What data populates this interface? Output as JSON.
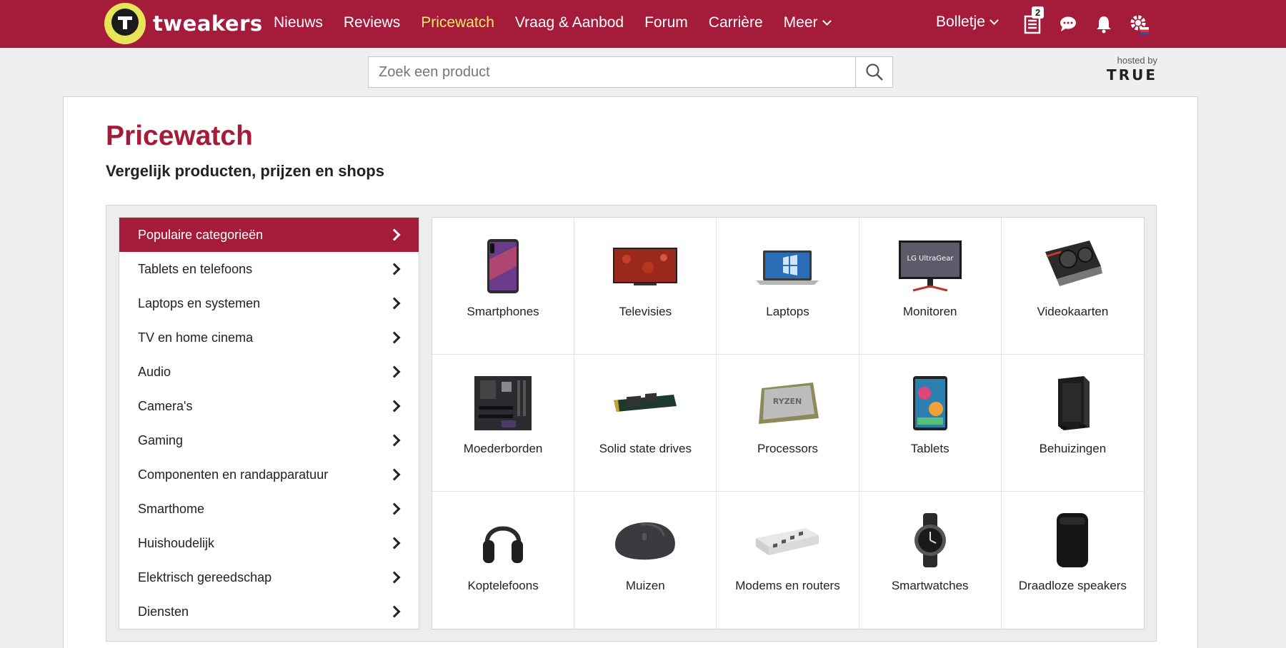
{
  "brand": {
    "name": "tweakers",
    "accent": "#a51c3a",
    "highlight": "#f3e96a"
  },
  "nav": {
    "items": [
      {
        "label": "Nieuws"
      },
      {
        "label": "Reviews"
      },
      {
        "label": "Pricewatch",
        "active": true
      },
      {
        "label": "Vraag & Aanbod"
      },
      {
        "label": "Forum"
      },
      {
        "label": "Carrière"
      },
      {
        "label": "Meer"
      }
    ],
    "user": "Bolletje",
    "list_badge": "2"
  },
  "search": {
    "placeholder": "Zoek een product"
  },
  "hosted": {
    "label": "hosted by",
    "brand": "TRUE"
  },
  "page": {
    "title": "Pricewatch",
    "subtitle": "Vergelijk producten, prijzen en shops"
  },
  "categories": [
    "Populaire categorieën",
    "Tablets en telefoons",
    "Laptops en systemen",
    "TV en home cinema",
    "Audio",
    "Camera's",
    "Gaming",
    "Componenten en randapparatuur",
    "Smarthome",
    "Huishoudelijk",
    "Elektrisch gereedschap",
    "Diensten"
  ],
  "products": [
    {
      "label": "Smartphones",
      "icon": "smartphone-icon"
    },
    {
      "label": "Televisies",
      "icon": "television-icon"
    },
    {
      "label": "Laptops",
      "icon": "laptop-icon"
    },
    {
      "label": "Monitoren",
      "icon": "monitor-icon"
    },
    {
      "label": "Videokaarten",
      "icon": "videocard-icon"
    },
    {
      "label": "Moederborden",
      "icon": "motherboard-icon"
    },
    {
      "label": "Solid state drives",
      "icon": "ssd-icon"
    },
    {
      "label": "Processors",
      "icon": "processor-icon"
    },
    {
      "label": "Tablets",
      "icon": "tablet-icon"
    },
    {
      "label": "Behuizingen",
      "icon": "case-icon"
    },
    {
      "label": "Koptelefoons",
      "icon": "headphones-icon"
    },
    {
      "label": "Muizen",
      "icon": "mouse-icon"
    },
    {
      "label": "Modems en routers",
      "icon": "router-icon"
    },
    {
      "label": "Smartwatches",
      "icon": "smartwatch-icon"
    },
    {
      "label": "Draadloze speakers",
      "icon": "speaker-icon"
    }
  ]
}
